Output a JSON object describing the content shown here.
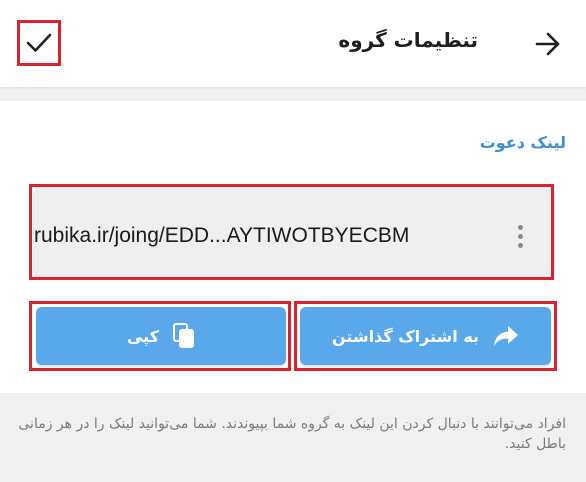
{
  "header": {
    "title": "تنظیمات گروه",
    "back_icon": "arrow-right-icon",
    "confirm_icon": "checkmark-icon"
  },
  "invite": {
    "section_title": "لینک دعوت",
    "link": "rubika.ir/joing/EDD...AYTIWOTBYECBM",
    "more_icon": "vertical-dots-icon"
  },
  "actions": {
    "copy_label": "کپی",
    "copy_icon": "copy-icon",
    "share_label": "به اشتراک گذاشتن",
    "share_icon": "share-arrow-icon"
  },
  "note": {
    "text": "افراد می‌توانند با دنبال کردن این لینک به گروه شما بپیوندند. شما می‌توانید لینک را در هر زمانی باطل کنید."
  },
  "colors": {
    "accent": "#58a8ea",
    "section_title": "#3d8fd1",
    "highlight": "#d9232e"
  }
}
